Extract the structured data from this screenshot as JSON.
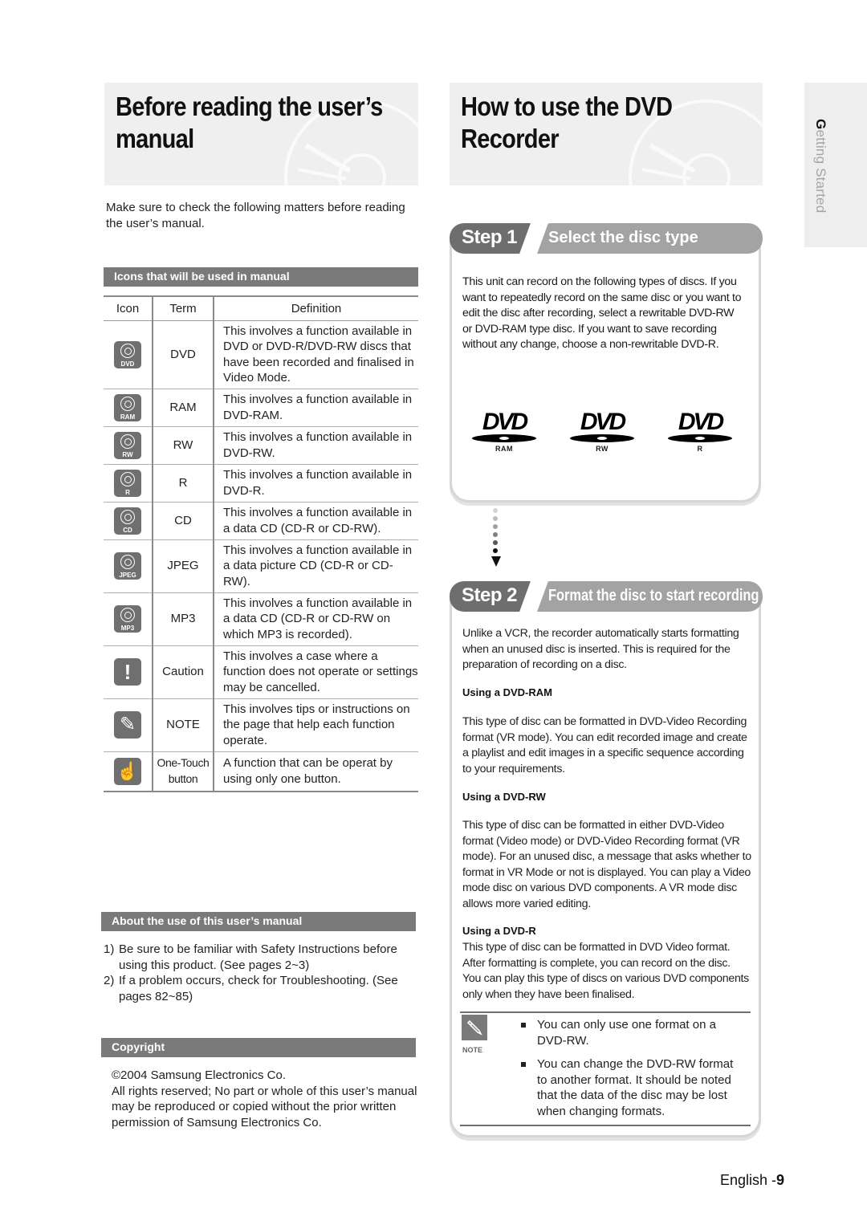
{
  "left": {
    "title_line1": "Before reading the user’s",
    "title_line2": "manual",
    "intro": "Make sure to check the following matters before reading the user’s manual.",
    "icons_section": {
      "heading": "Icons that will be used in manual",
      "columns": [
        "Icon",
        "Term",
        "Definition"
      ],
      "rows": [
        {
          "icon": "disc-icon",
          "icon_label": "DVD",
          "term": "DVD",
          "definition": "This involves a function available in DVD or DVD-R/DVD-RW discs that have been recorded and finalised in Video Mode."
        },
        {
          "icon": "disc-icon",
          "icon_label": "RAM",
          "term": "RAM",
          "definition": "This involves a function available in DVD-RAM."
        },
        {
          "icon": "disc-icon",
          "icon_label": "RW",
          "term": "RW",
          "definition": "This involves a function available in DVD-RW."
        },
        {
          "icon": "disc-icon",
          "icon_label": "R",
          "term": "R",
          "definition": "This involves a function available in DVD-R."
        },
        {
          "icon": "disc-icon",
          "icon_label": "CD",
          "term": "CD",
          "definition": "This involves a function available in a data CD (CD-R or CD-RW)."
        },
        {
          "icon": "disc-icon",
          "icon_label": "JPEG",
          "term": "JPEG",
          "definition": "This involves a function available in a data picture CD (CD-R or CD-RW)."
        },
        {
          "icon": "disc-icon",
          "icon_label": "MP3",
          "term": "MP3",
          "definition": "This involves a function available in a data CD (CD-R or CD-RW on which MP3 is recorded)."
        },
        {
          "icon": "caution-icon",
          "icon_label": "!",
          "term": "Caution",
          "definition": "This involves a case where a function does not operate or settings may be cancelled."
        },
        {
          "icon": "note-pencil-icon",
          "icon_label": "✎",
          "term": "NOTE",
          "definition": "This involves tips or instructions on the page that help each function operate."
        },
        {
          "icon": "one-touch-hand-icon",
          "icon_label": "☝",
          "term_line1": "One-Touch",
          "term_line2": "button",
          "definition": "A function that can be operat by using only one button."
        }
      ]
    },
    "about_section": {
      "heading": "About the use of this user’s manual",
      "items": [
        {
          "num": "1)",
          "text": "Be sure to be familiar with Safety Instructions before using this product. (See pages 2~3)"
        },
        {
          "num": "2)",
          "text": "If a problem occurs, check for Troubleshooting. (See pages 82~85)"
        }
      ]
    },
    "copyright_section": {
      "heading": "Copyright",
      "line1": "©2004 Samsung Electronics Co.",
      "line2": "All rights reserved; No part or whole of this user’s manual may be reproduced or copied without the prior written permission of Samsung Electronics Co."
    }
  },
  "right": {
    "title_line1": "How to use the DVD",
    "title_line2": "Recorder",
    "step1": {
      "step_label": "Step 1",
      "title": "Select the disc type",
      "text": "This unit can record on the following types of discs. If you want to repeatedly record on the same disc or you want to edit the disc after recording, select a rewritable DVD-RW or DVD-RAM type disc. If you want to save recording without any change, choose a non-rewritable DVD-R.",
      "logos": [
        {
          "word": "DVD",
          "sub": "RAM"
        },
        {
          "word": "DVD",
          "sub": "RW"
        },
        {
          "word": "DVD",
          "sub": "R"
        }
      ]
    },
    "step2": {
      "step_label": "Step 2",
      "title": "Format the disc to start recording",
      "intro": "Unlike a VCR, the recorder automatically starts formatting when an unused disc is inserted. This is required for the preparation of recording on a disc.",
      "ram_heading": "Using a DVD-RAM",
      "ram_text": "This type of disc can be formatted in DVD-Video Recording format (VR mode). You can edit recorded image and create a playlist and edit images in a specific sequence according to your requirements.",
      "rw_heading": "Using a DVD-RW",
      "rw_text": "This type of disc can be formatted in either DVD-Video format (Video mode) or DVD-Video Recording format (VR mode). For an unused disc, a message that asks whether to format in VR Mode or not is displayed. You can play a Video mode disc on various DVD components. A VR mode disc allows more varied editing.",
      "r_heading": "Using a DVD-R",
      "r_text": "This type of disc can be formatted in DVD Video format. After formatting is complete, you can record on the disc. You can play this type of discs on various DVD components only when they have been finalised."
    },
    "note": {
      "label": "NOTE",
      "items": [
        "You can only use one format on a DVD-RW.",
        "You can change the DVD-RW format to another format. It should be noted that the data of the disc may be lost when changing formats."
      ]
    }
  },
  "side_tab": {
    "first_letter": "G",
    "rest": "etting Started"
  },
  "footer": {
    "language": "English -",
    "page_number": "9"
  }
}
